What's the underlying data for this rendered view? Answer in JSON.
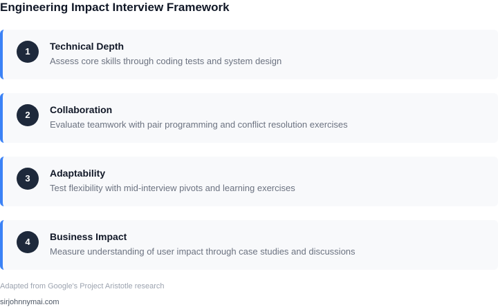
{
  "title": "Engineering Impact Interview Framework",
  "cards": [
    {
      "number": "1",
      "title": "Technical Depth",
      "description": "Assess core skills through coding tests and system design"
    },
    {
      "number": "2",
      "title": "Collaboration",
      "description": "Evaluate teamwork with pair programming and conflict resolution exercises"
    },
    {
      "number": "3",
      "title": "Adaptability",
      "description": "Test flexibility with mid-interview pivots and learning exercises"
    },
    {
      "number": "4",
      "title": "Business Impact",
      "description": "Measure understanding of user impact through case studies and discussions"
    }
  ],
  "footnote": "Adapted from Google's Project Aristotle research",
  "site": "sirjohnnymai.com",
  "colors": {
    "accent": "#3b82f6",
    "badge": "#1e293b",
    "card_background": "#f8f9fb"
  }
}
